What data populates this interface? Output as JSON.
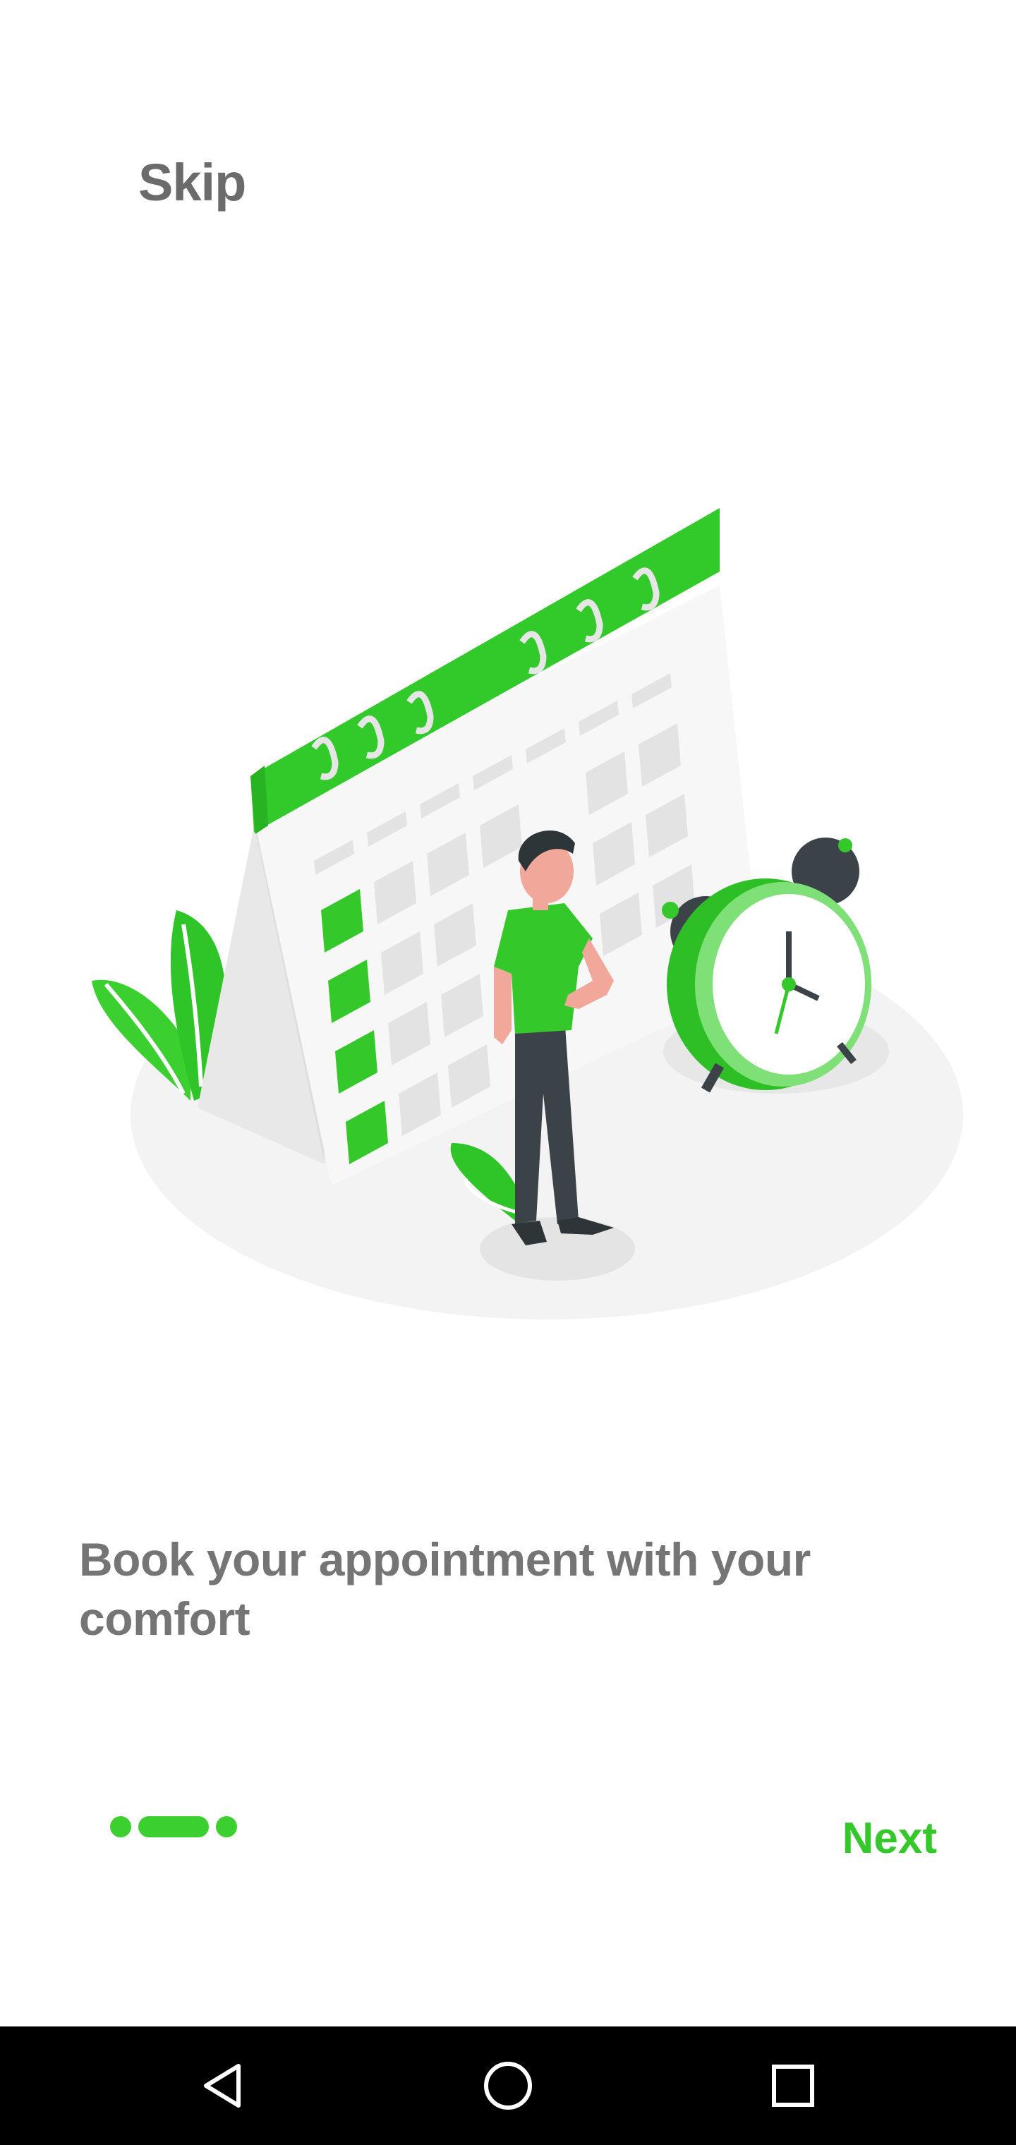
{
  "onboarding": {
    "skip_label": "Skip",
    "headline": "Book your appointment with your comfort",
    "next_label": "Next",
    "page_indicator": {
      "total_pages": 3,
      "active_index": 1
    }
  },
  "illustration": {
    "description_icon": "calendar-clock-person-illustration"
  },
  "system_nav": {
    "back_icon": "back-triangle-icon",
    "home_icon": "home-circle-icon",
    "recents_icon": "recents-square-icon"
  },
  "colors": {
    "accent": "#35c82a",
    "text_gray": "#757575",
    "skip_gray": "#6b6b6b"
  }
}
